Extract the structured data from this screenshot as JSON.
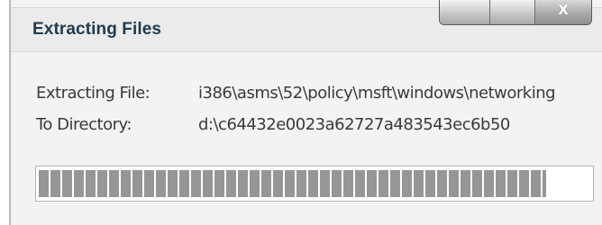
{
  "window": {
    "title": "Extracting Files",
    "buttons": {
      "close_glyph": "X"
    }
  },
  "details": {
    "file_label": "Extracting File:",
    "file_value": "i386\\asms\\52\\policy\\msft\\windows\\networking",
    "dir_label": "To Directory:",
    "dir_value": "d:\\c64432e0023a62727a483543ec6b50"
  },
  "progress": {
    "fraction": 0.92
  }
}
